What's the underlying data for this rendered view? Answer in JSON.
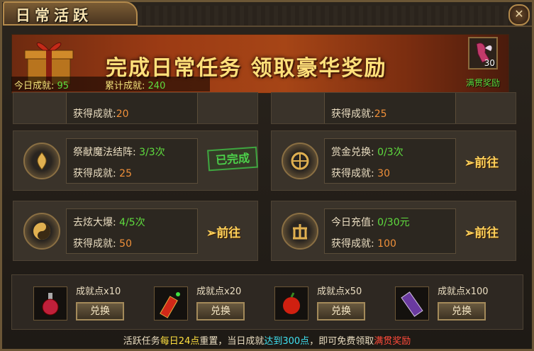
{
  "window": {
    "title": "日常活跃"
  },
  "banner": {
    "headline": "完成日常任务 领取豪华奖励"
  },
  "stats": {
    "today_label": "今日成就:",
    "today_value": "95",
    "total_label": "累计成就:",
    "total_value": "240"
  },
  "full_reward": {
    "count": "30",
    "label": "满贯奖励"
  },
  "tasks": [
    {
      "name": "",
      "progress": "",
      "reward_label": "获得成就:",
      "reward": "20",
      "status": "done"
    },
    {
      "name": "",
      "progress": "",
      "reward_label": "获得成就:",
      "reward": "25",
      "status": "unknown"
    },
    {
      "name": "祭献魔法结阵:",
      "progress": "3/3次",
      "reward_label": "获得成就:",
      "reward": "25",
      "status_text": "已完成",
      "icon": "flame-icon"
    },
    {
      "name": "赏金兑换:",
      "progress": "0/3次",
      "reward_label": "获得成就:",
      "reward": "30",
      "status_text": "前往",
      "icon": "orb-icon"
    },
    {
      "name": "去炫大爆:",
      "progress": "4/5次",
      "reward_label": "获得成就:",
      "reward": "50",
      "status_text": "前往",
      "icon": "yin-yang-icon"
    },
    {
      "name": "今日充值:",
      "progress": "0/30元",
      "reward_label": "获得成就:",
      "reward": "100",
      "status_text": "前往",
      "icon": "coin-icon"
    }
  ],
  "exchange": [
    {
      "label": "成就点x10",
      "button": "兑换",
      "icon": "potion-icon"
    },
    {
      "label": "成就点x20",
      "button": "兑换",
      "icon": "firecracker-icon"
    },
    {
      "label": "成就点x50",
      "button": "兑换",
      "icon": "apple-icon"
    },
    {
      "label": "成就点x100",
      "button": "兑换",
      "icon": "scroll-icon"
    }
  ],
  "footer": {
    "p1": "活跃任务",
    "p2": "每日24点",
    "p3": "重置，当日成就",
    "p4": "达到300点",
    "p5": "，即可免费领取",
    "p6": "满贯奖励"
  }
}
